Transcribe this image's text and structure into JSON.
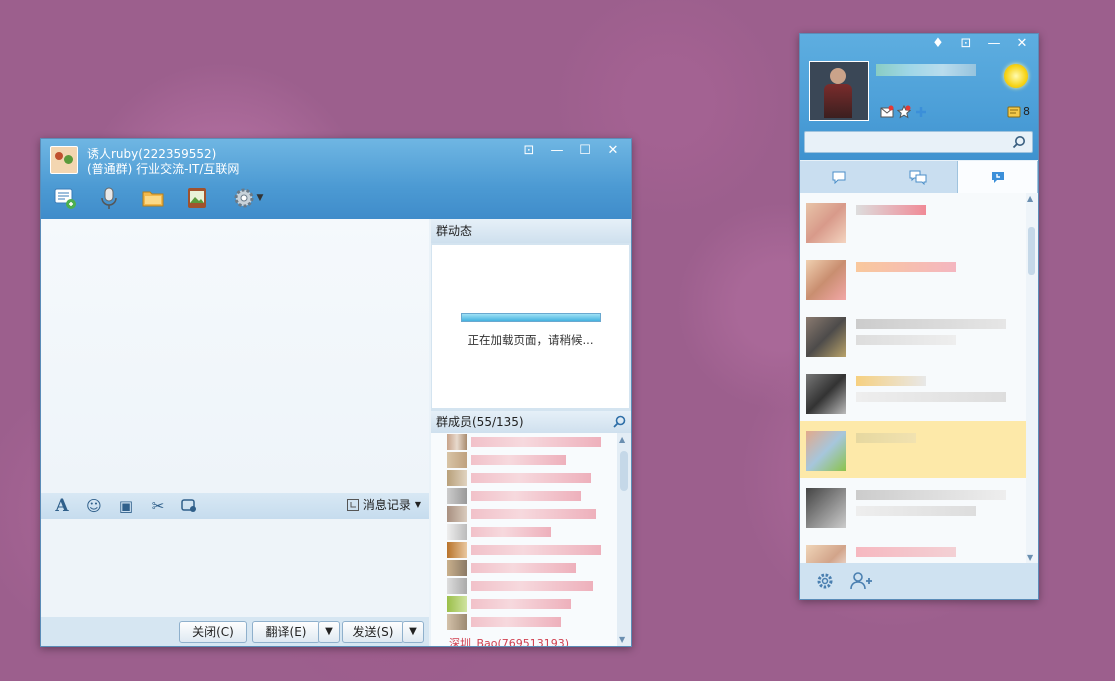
{
  "chat": {
    "group_name": "诱人ruby(222359552)",
    "group_desc": "(普通群) 行业交流-IT/互联网",
    "controls": {
      "dropdown": "⊡",
      "minimize": "—",
      "maximize": "☐",
      "close": "✕"
    },
    "toolbar": [
      {
        "name": "group-chat-icon"
      },
      {
        "name": "microphone-icon"
      },
      {
        "name": "folder-icon"
      },
      {
        "name": "album-icon"
      },
      {
        "name": "settings-gear-icon"
      }
    ],
    "format_bar": {
      "font": "A",
      "emoji": "☺",
      "image": "▣",
      "screenshot": "✂",
      "history_label": "消息记录"
    },
    "buttons": {
      "close": "关闭(C)",
      "translate": "翻译(E)",
      "send": "发送(S)"
    },
    "activity": {
      "title": "群动态",
      "loading_text": "正在加载页面，请稍候..."
    },
    "members": {
      "title": "群成员(55/135)",
      "last_visible": "深圳_Bao(769513193)"
    }
  },
  "panel": {
    "controls": {
      "skin": "♦",
      "dropdown": "⊡",
      "minimize": "—",
      "close": "✕"
    },
    "weather_count": "8",
    "search": {
      "placeholder": ""
    },
    "tabs": [
      {
        "name": "tab-contacts"
      },
      {
        "name": "tab-groups"
      },
      {
        "name": "tab-recent"
      }
    ]
  },
  "colors": {
    "desktop": "#9c5f8d",
    "titlebar": "#4c9ad3",
    "selected_row": "#fde9a9",
    "loading_bar": "#45b2df"
  }
}
